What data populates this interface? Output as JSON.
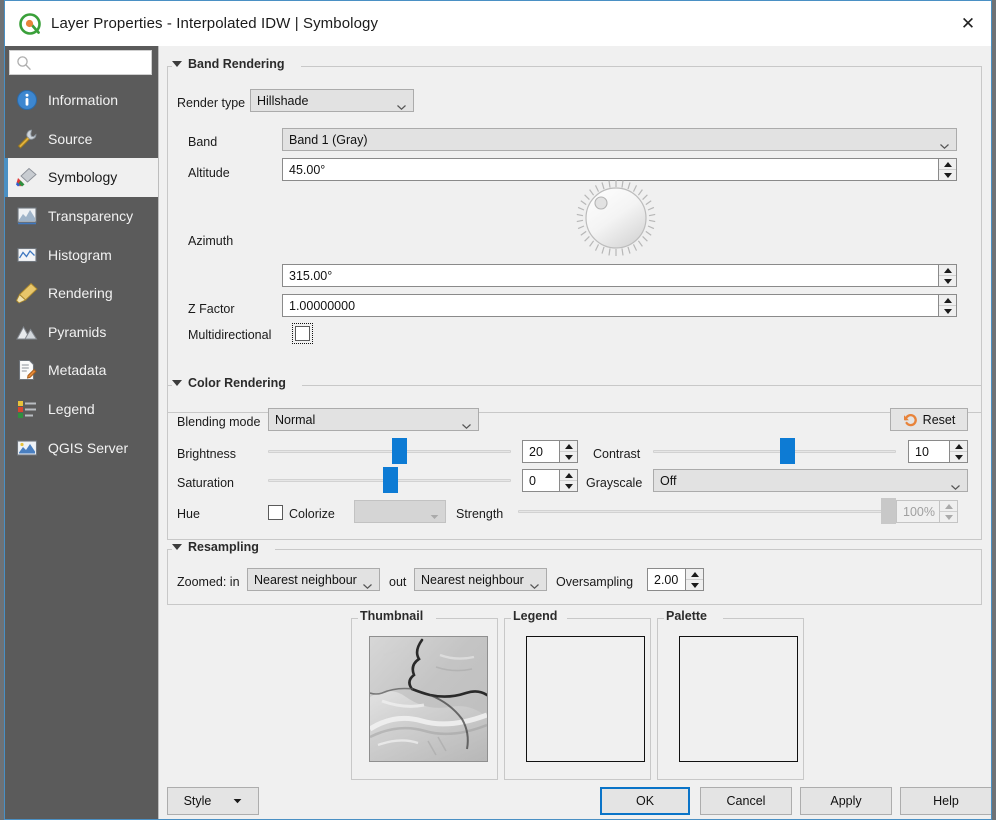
{
  "window": {
    "title": "Layer Properties - Interpolated IDW | Symbology",
    "app_icon": "qgis-logo-icon",
    "close_label": "✕"
  },
  "sidebar": {
    "search": {
      "placeholder": "",
      "value": "",
      "icon": "search-icon"
    },
    "items": [
      {
        "label": "Information",
        "icon": "information-icon",
        "active": false
      },
      {
        "label": "Source",
        "icon": "source-icon",
        "active": false
      },
      {
        "label": "Symbology",
        "icon": "symbology-icon",
        "active": true
      },
      {
        "label": "Transparency",
        "icon": "transparency-icon",
        "active": false
      },
      {
        "label": "Histogram",
        "icon": "histogram-icon",
        "active": false
      },
      {
        "label": "Rendering",
        "icon": "rendering-icon",
        "active": false
      },
      {
        "label": "Pyramids",
        "icon": "pyramids-icon",
        "active": false
      },
      {
        "label": "Metadata",
        "icon": "metadata-icon",
        "active": false
      },
      {
        "label": "Legend",
        "icon": "legend-icon",
        "active": false
      },
      {
        "label": "QGIS Server",
        "icon": "qgis-server-icon",
        "active": false
      }
    ]
  },
  "band_rendering": {
    "title": "Band Rendering",
    "render_type_label": "Render type",
    "render_type_value": "Hillshade",
    "band_label": "Band",
    "band_value": "Band 1 (Gray)",
    "altitude_label": "Altitude",
    "altitude_value": "45.00°",
    "azimuth_label": "Azimuth",
    "azimuth_value": "315.00°",
    "z_factor_label": "Z Factor",
    "z_factor_value": "1.00000000",
    "multidirectional_label": "Multidirectional",
    "multidirectional_checked": false
  },
  "color_rendering": {
    "title": "Color Rendering",
    "blending_mode_label": "Blending mode",
    "blending_mode_value": "Normal",
    "reset_label": "Reset",
    "brightness_label": "Brightness",
    "brightness_value": "20",
    "contrast_label": "Contrast",
    "contrast_value": "10",
    "saturation_label": "Saturation",
    "saturation_value": "0",
    "grayscale_label": "Grayscale",
    "grayscale_value": "Off",
    "hue_label": "Hue",
    "colorize_label": "Colorize",
    "colorize_checked": false,
    "strength_label": "Strength",
    "strength_value": "100%"
  },
  "resampling": {
    "title": "Resampling",
    "zoomed_in_label": "Zoomed: in",
    "zoomed_in_value": "Nearest neighbour",
    "zoomed_out_label": "out",
    "zoomed_out_value": "Nearest neighbour",
    "oversampling_label": "Oversampling",
    "oversampling_value": "2.00"
  },
  "previews": {
    "thumbnail_label": "Thumbnail",
    "legend_label": "Legend",
    "palette_label": "Palette"
  },
  "footer": {
    "style_label": "Style",
    "ok_label": "OK",
    "cancel_label": "Cancel",
    "apply_label": "Apply",
    "help_label": "Help"
  },
  "colors": {
    "accent_blue": "#0d7bd4",
    "default_btn_border": "#0a74c8",
    "reset_orange": "#e8833a",
    "sidebar_bg": "#5b5b5b",
    "dialog_bg": "#f0f0f0"
  },
  "slider_positions": {
    "brightness_pct": 54,
    "contrast_pct": 55,
    "saturation_pct": 50,
    "strength_pct": 100
  }
}
